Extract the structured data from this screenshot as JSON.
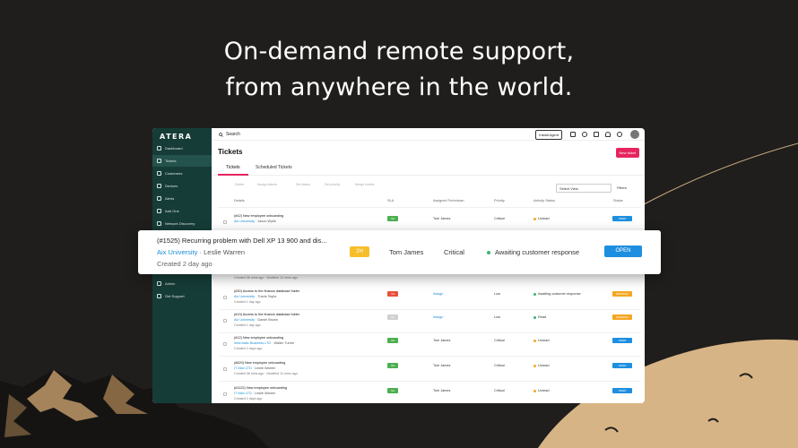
{
  "hero": {
    "line1": "On-demand remote support,",
    "line2": "from anywhere in the world."
  },
  "colors": {
    "background": "#1f1e1c",
    "sidebar": "#163c37",
    "accent": "#e6245e",
    "link": "#1d8fd6",
    "open": "#1e8fe0",
    "sla_hours": "#f7be2c"
  },
  "app": {
    "logo": "ATERA",
    "search_label": "Search",
    "install_agent": "Install Agent",
    "page_title": "Tickets",
    "new_ticket": "New ticket",
    "tabs": [
      "Tickets",
      "Scheduled Tickets"
    ],
    "actions": [
      "Delete",
      "Assign tickets",
      "Set status",
      "Set priority",
      "Merge tickets"
    ],
    "select_view": "Select View",
    "filters": "Filters",
    "columns": [
      "Details",
      "SLA",
      "Assigned Technician",
      "Priority",
      "Activity Status",
      "Status"
    ],
    "sidebar": [
      {
        "label": "Dashboard",
        "icon": "dashboard-icon"
      },
      {
        "label": "Tickets",
        "icon": "ticket-icon"
      },
      {
        "label": "Customers",
        "icon": "customers-icon"
      },
      {
        "label": "Devices",
        "icon": "devices-icon"
      },
      {
        "label": "Alerts",
        "icon": "alert-icon"
      },
      {
        "label": "Add One",
        "icon": "add-icon"
      },
      {
        "label": "Network Discovery",
        "icon": "network-icon"
      },
      {
        "label": "Admin",
        "icon": "admin-icon"
      },
      {
        "label": "Get Support",
        "icon": "support-icon"
      }
    ],
    "rows": [
      {
        "title": "(#42) New employee onboarding",
        "company": "Aix University",
        "contact": "Jaxon Wylie",
        "meta": "",
        "sla": "9H",
        "sla_color": "#4caf50",
        "tech": "Tom James",
        "tech_link": false,
        "priority": "Critical",
        "activity": "Unread",
        "activity_color": "#f5a623",
        "status": "OPEN",
        "status_color": "#1e8fe0"
      },
      {
        "title": "(#30) Access to the finance database folder",
        "company": "Aix University",
        "contact": "Travis Taylor",
        "meta": "Created 1 day ago",
        "sla": "1H",
        "sla_color": "#e8503a",
        "tech": "Assign",
        "tech_link": true,
        "priority": "Low",
        "activity": "Awaiting customer response",
        "activity_color": "#3cb371",
        "status": "PENDING",
        "status_color": "#f5a623"
      },
      {
        "title": "(#19) Access to the finance database folder",
        "company": "Aix University",
        "contact": "Daniel Brown",
        "meta": "Created 1 day ago",
        "sla": "N/A",
        "sla_color": "#d0d0d0",
        "tech": "Assign",
        "tech_link": true,
        "priority": "Low",
        "activity": "Read",
        "activity_color": "#3cb371",
        "status": "PENDING",
        "status_color": "#f5a623"
      },
      {
        "title": "(#12) New employee onboarding",
        "company": "Informatic Business LTD",
        "contact": "Walter Turner",
        "meta": "Created 2 days ago",
        "sla": "9H",
        "sla_color": "#4caf50",
        "tech": "Tom James",
        "tech_link": false,
        "priority": "Critical",
        "activity": "Unread",
        "activity_color": "#f5a623",
        "status": "OPEN",
        "status_color": "#1e8fe0"
      },
      {
        "title": "(#620) New employee onboarding",
        "company": "IT Man LTD",
        "contact": "Leslie Warren",
        "meta": "Created 36 mins ago · Modified 12 mins ago",
        "sla": "9H",
        "sla_color": "#4caf50",
        "tech": "Tom James",
        "tech_link": false,
        "priority": "Critical",
        "activity": "Unread",
        "activity_color": "#f5a623",
        "status": "OPEN",
        "status_color": "#1e8fe0"
      },
      {
        "title": "(#1122) New employee onboarding",
        "company": "IT Man LTD",
        "contact": "Leslie Warren",
        "meta": "Created 2 days ago",
        "sla": "9H",
        "sla_color": "#4caf50",
        "tech": "Tom James",
        "tech_link": false,
        "priority": "Critical",
        "activity": "Unread",
        "activity_color": "#f5a623",
        "status": "OPEN",
        "status_color": "#1e8fe0"
      }
    ],
    "hidden_row_meta": "Created 36 mins ago · Modified 12 mins ago"
  },
  "highlight": {
    "title": "(#1525) Recurring problem with Dell XP 13 900 and dis...",
    "company": "Aix University",
    "contact": "· Leslie Warren",
    "meta": "Created 2 day ago",
    "sla": "2H",
    "tech": "Tom James",
    "priority": "Critical",
    "activity": "Awaiting customer response",
    "status": "OPEN"
  }
}
